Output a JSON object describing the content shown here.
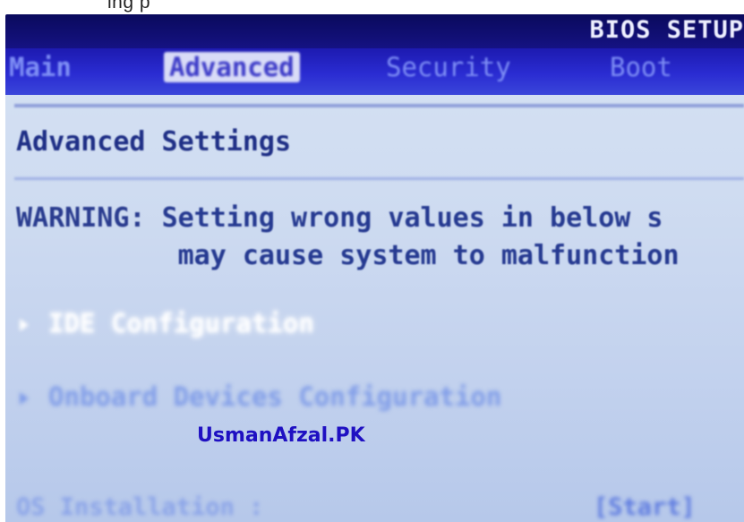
{
  "header": {
    "title": "BIOS SETUP",
    "above_text": "ing                            p"
  },
  "tabs": [
    {
      "label": "Main",
      "active": false
    },
    {
      "label": "Advanced",
      "active": true
    },
    {
      "label": "Security",
      "active": false
    },
    {
      "label": "Boot",
      "active": false
    }
  ],
  "main": {
    "section_title": "Advanced Settings",
    "warning_label": "WARNING:",
    "warning_line1": "Setting wrong values in below s",
    "warning_line2": "may cause system to malfunction",
    "menu_items": [
      {
        "label": "IDE Configuration",
        "selected": true
      },
      {
        "label": "Onboard Devices Configuration",
        "selected": false
      }
    ],
    "os_installation": {
      "label": "OS Installation :",
      "value": "[Start]"
    }
  },
  "watermark": "UsmanAfzal.PK",
  "colors": {
    "header_bg": "#0a0a5c",
    "tab_bg": "#2a2cd2",
    "panel_bg": "#cfdcf1",
    "text": "#263a91",
    "watermark": "#1f10c2"
  }
}
